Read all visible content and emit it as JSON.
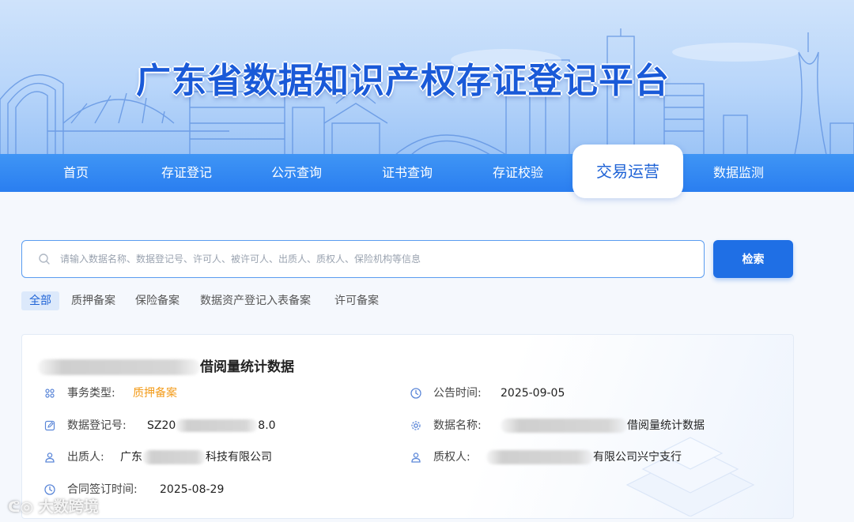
{
  "banner": {
    "title": "广东省数据知识产权存证登记平台"
  },
  "nav": {
    "items": [
      {
        "label": "首页"
      },
      {
        "label": "存证登记"
      },
      {
        "label": "公示查询"
      },
      {
        "label": "证书查询"
      },
      {
        "label": "存证校验"
      },
      {
        "label": "交易运营"
      },
      {
        "label": "数据监测"
      }
    ],
    "active": "交易运营"
  },
  "search": {
    "placeholder": "请输入数据名称、数据登记号、许可人、被许可人、出质人、质权人、保险机构等信息",
    "value": "",
    "button_label": "检索"
  },
  "filters": {
    "items": [
      {
        "label": "全部"
      },
      {
        "label": "质押备案"
      },
      {
        "label": "保险备案"
      },
      {
        "label": "数据资产登记入表备案"
      },
      {
        "label": "许可备案"
      }
    ],
    "active": "全部"
  },
  "result": {
    "title_visible": "借阅量统计数据",
    "business_type_label": "事务类型:",
    "business_type_value": "质押备案",
    "announce_time_label": "公告时间:",
    "announce_time_value": "2025-09-05",
    "reg_no_label": "数据登记号:",
    "reg_no_prefix": "SZ20",
    "reg_no_suffix": "8.0",
    "data_name_label": "数据名称:",
    "data_name_visible": "借阅量统计数据",
    "pledgor_label": "出质人:",
    "pledgor_prefix": "广东",
    "pledgor_suffix": "科技有限公司",
    "pledgee_label": "质权人:",
    "pledgee_suffix": "有限公司兴宁支行",
    "contract_time_label": "合同签订时间:",
    "contract_time_value": "2025-08-29"
  },
  "watermark": {
    "text": "大数跨境"
  },
  "colors": {
    "primary": "#1f6fe5",
    "nav_bg": "#3f95f5",
    "accent_orange": "#f39b19",
    "title_blue": "#1a5ad8"
  }
}
